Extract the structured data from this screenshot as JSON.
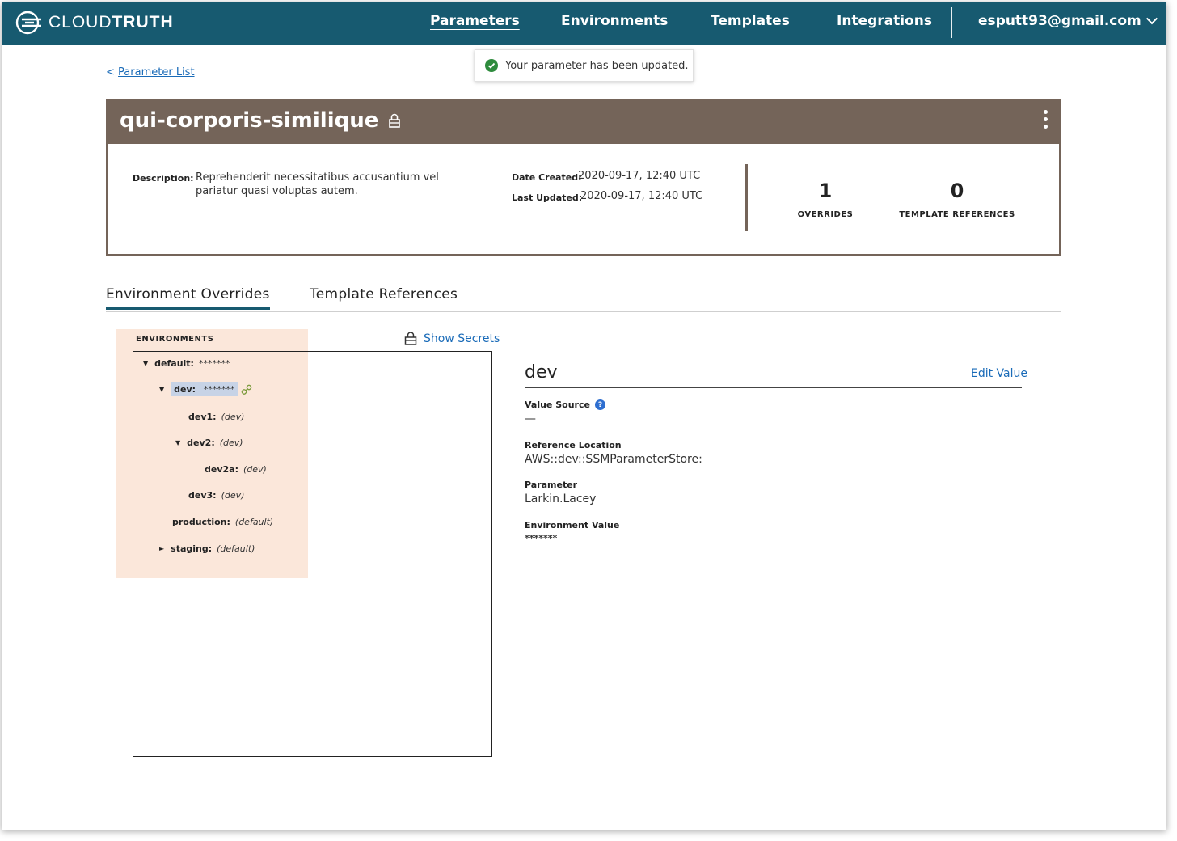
{
  "nav": {
    "logo_light": "CLOUD",
    "logo_bold": "TRUTH",
    "items": [
      "Parameters",
      "Environments",
      "Templates",
      "Integrations"
    ],
    "active": "Parameters",
    "user": "esputt93@gmail.com"
  },
  "back_link": {
    "prefix": "<",
    "label": "Parameter List"
  },
  "toast": {
    "message": "Your parameter has been updated."
  },
  "parameter": {
    "name": "qui-corporis-similique",
    "description_label": "Description:",
    "description": "Reprehenderit necessitatibus accusantium vel pariatur quasi voluptas autem.",
    "date_created_label": "Date Created:",
    "date_created": "2020-09-17, 12:40 UTC",
    "last_updated_label": "Last Updated:",
    "last_updated": "2020-09-17, 12:40 UTC",
    "overrides_count": "1",
    "overrides_label": "OVERRIDES",
    "template_refs_count": "0",
    "template_refs_label": "TEMPLATE REFERENCES"
  },
  "tabs": [
    "Environment Overrides",
    "Template References"
  ],
  "environments": {
    "heading": "ENVIRONMENTS",
    "show_secrets": "Show Secrets",
    "tree": [
      {
        "name": "default:",
        "value": "*******",
        "masked": true,
        "toggle": "▼"
      },
      {
        "name": "dev:",
        "value": "*******",
        "masked": true,
        "toggle": "▼",
        "selected": true
      },
      {
        "name": "dev1:",
        "value": "(dev)",
        "toggle": ""
      },
      {
        "name": "dev2:",
        "value": "(dev)",
        "toggle": "▼"
      },
      {
        "name": "dev2a:",
        "value": "(dev)",
        "toggle": ""
      },
      {
        "name": "dev3:",
        "value": "(dev)",
        "toggle": ""
      },
      {
        "name": "production:",
        "value": "(default)",
        "toggle": ""
      },
      {
        "name": "staging:",
        "value": "(default)",
        "toggle": "►"
      }
    ]
  },
  "detail": {
    "title": "dev",
    "edit_label": "Edit Value",
    "value_source_label": "Value Source",
    "value_source": "—",
    "reference_location_label": "Reference Location",
    "reference_location": "AWS::dev::SSMParameterStore:",
    "parameter_label": "Parameter",
    "parameter": "Larkin.Lacey",
    "environment_value_label": "Environment Value",
    "environment_value": "*******"
  },
  "colors": {
    "nav_bg": "#175a70",
    "header_bg": "#746459",
    "link": "#1a6bb8",
    "highlight": "#fbe7da",
    "selected": "#c7d3e6",
    "success": "#2e8b3d"
  }
}
